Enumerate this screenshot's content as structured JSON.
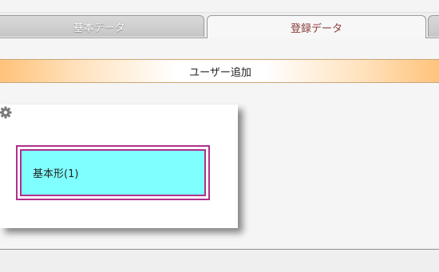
{
  "tabs": [
    {
      "label": "基本データ",
      "active": false
    },
    {
      "label": "登録データ",
      "active": true
    }
  ],
  "toolbar": {
    "add_user_label": "ユーザー追加"
  },
  "card": {
    "settings_icon": "gear-icon",
    "shape_label": "基本形(1)"
  },
  "colors": {
    "active_tab_text": "#8b3b3b",
    "bar_gradient_edge": "#ffc27a",
    "shape_fill": "#7fffff",
    "shape_border": "#b0308d"
  }
}
